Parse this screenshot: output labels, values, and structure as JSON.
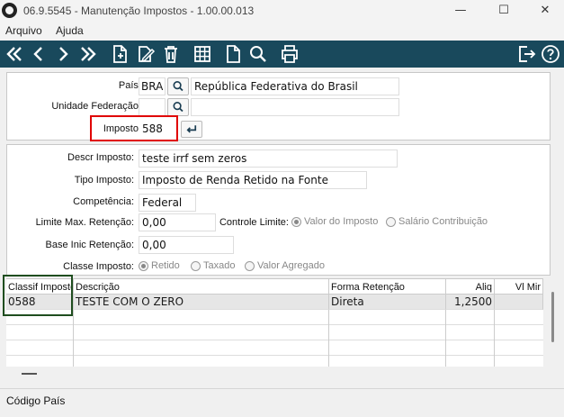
{
  "window": {
    "title": "06.9.5545 - Manutenção Impostos - 1.00.00.013",
    "minimize": "—",
    "maximize": "☐",
    "close": "✕"
  },
  "menu": {
    "items": [
      "Arquivo",
      "Ajuda"
    ]
  },
  "toolbar": {
    "icons": [
      "first-icon",
      "previous-icon",
      "next-icon",
      "last-icon",
      "new-icon",
      "edit-icon",
      "delete-icon",
      "grid-icon",
      "document-icon",
      "search-icon",
      "print-icon",
      "exit-icon",
      "help-icon"
    ]
  },
  "filter": {
    "pais_label": "País:",
    "pais_code": "BRA",
    "pais_name": "República Federativa do Brasil",
    "uf_label": "Unidade Federação:",
    "uf_code": "",
    "uf_name": "",
    "imposto_label": "Imposto:",
    "imposto_value": "588"
  },
  "detail": {
    "descr_label": "Descr  Imposto:",
    "descr_value": "teste irrf sem zeros",
    "tipo_label": "Tipo Imposto:",
    "tipo_value": "Imposto de Renda Retido na Fonte",
    "competencia_label": "Competência:",
    "competencia_value": "Federal",
    "limite_label": "Limite Max. Retenção:",
    "limite_value": "0,00",
    "controle_label": "Controle Limite:",
    "controle_options": [
      "Valor do Imposto",
      "Salário Contribuição"
    ],
    "controle_selected": 0,
    "base_label": "Base Inic Retenção:",
    "base_value": "0,00",
    "classe_label": "Classe Imposto:",
    "classe_options": [
      "Retido",
      "Taxado",
      "Valor Agregado"
    ],
    "classe_selected": 0
  },
  "grid": {
    "columns": [
      "Classif Imposto",
      "Descrição",
      "Forma Retenção",
      "Aliq",
      "Vl Mir"
    ],
    "rows": [
      [
        "0588",
        "TESTE COM O ZERO",
        "Direta",
        "1,2500",
        ""
      ]
    ]
  },
  "status": {
    "text": "Código País"
  },
  "colors": {
    "toolbar": "#19495c",
    "highlight_red": "#e00000",
    "highlight_green": "#1f4d1f",
    "selected_row": "#e6e6e6"
  }
}
